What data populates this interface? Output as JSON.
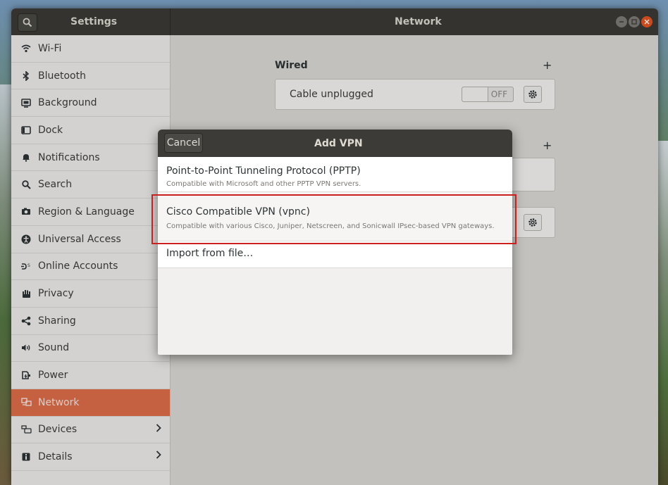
{
  "window": {
    "settings_title": "Settings",
    "panel_title": "Network",
    "buttons": [
      "minimize-icon",
      "maximize-icon",
      "close-icon"
    ]
  },
  "sidebar": {
    "items": [
      {
        "label": "Wi-Fi",
        "icon": "wifi-icon"
      },
      {
        "label": "Bluetooth",
        "icon": "bluetooth-icon"
      },
      {
        "label": "Background",
        "icon": "background-icon"
      },
      {
        "label": "Dock",
        "icon": "dock-icon"
      },
      {
        "label": "Notifications",
        "icon": "bell-icon"
      },
      {
        "label": "Search",
        "icon": "search-icon"
      },
      {
        "label": "Region & Language",
        "icon": "camera-icon"
      },
      {
        "label": "Universal Access",
        "icon": "accessibility-icon"
      },
      {
        "label": "Online Accounts",
        "icon": "online-accounts-icon"
      },
      {
        "label": "Privacy",
        "icon": "hand-icon"
      },
      {
        "label": "Sharing",
        "icon": "share-icon"
      },
      {
        "label": "Sound",
        "icon": "speaker-icon"
      },
      {
        "label": "Power",
        "icon": "power-icon"
      },
      {
        "label": "Network",
        "icon": "network-icon",
        "active": true
      },
      {
        "label": "Devices",
        "icon": "devices-icon",
        "has_chevron": true
      },
      {
        "label": "Details",
        "icon": "info-icon",
        "has_chevron": true
      }
    ]
  },
  "network": {
    "wired_title": "Wired",
    "add_symbol": "+",
    "cable_label": "Cable unplugged",
    "toggle_state": "OFF"
  },
  "dialog": {
    "title": "Add VPN",
    "cancel_label": "Cancel",
    "options": [
      {
        "name": "Point-to-Point Tunneling Protocol (PPTP)",
        "desc": "Compatible with Microsoft and other PPTP VPN servers."
      },
      {
        "name": "Cisco Compatible VPN (vpnc)",
        "desc": "Compatible with various Cisco, Juniper, Netscreen, and Sonicwall IPsec-based VPN gateways.",
        "highlighted": true
      },
      {
        "name": "Import from file…",
        "desc": ""
      }
    ]
  },
  "colors": {
    "accent": "#e16e49",
    "headerbar": "#3c3b37",
    "highlight": "#cc1f1f"
  }
}
